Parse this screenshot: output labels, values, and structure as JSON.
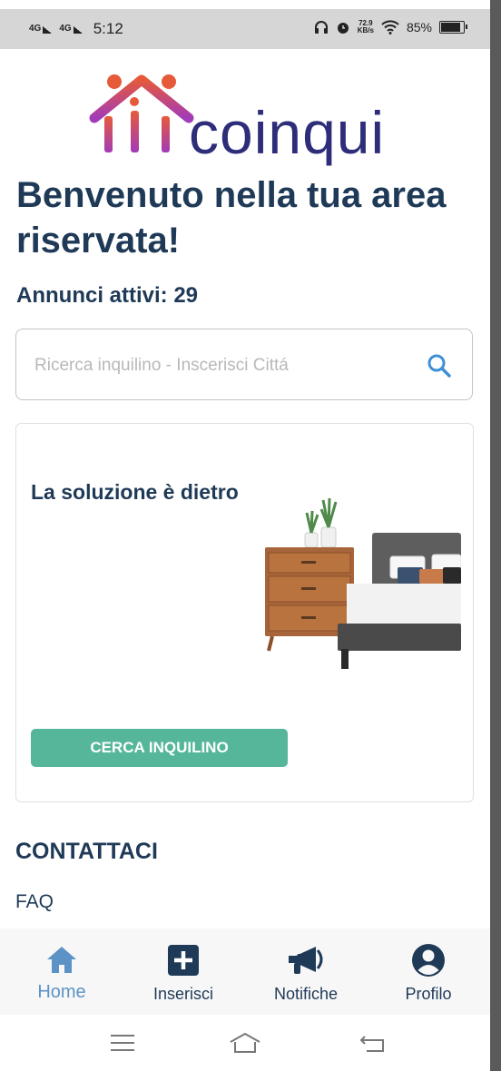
{
  "status_bar": {
    "network_1": "4G",
    "network_2": "4G",
    "time": "5:12",
    "speed_value": "72.9",
    "speed_unit": "KB/s",
    "battery": "85%"
  },
  "logo": {
    "text": "coinqui"
  },
  "header": {
    "title": "Benvenuto nella tua area riservata!",
    "active_ads": "Annunci attivi: 29"
  },
  "search": {
    "placeholder": "Ricerca inquilino - Inscerisci Cittá",
    "value": ""
  },
  "card": {
    "title": "La soluzione è dietro",
    "cta_label": "CERCA INQUILINO"
  },
  "links": {
    "contact": "CONTATTACI",
    "faq": "FAQ"
  },
  "bottom_nav": {
    "items": [
      {
        "label": "Home",
        "icon": "home-icon",
        "active": true
      },
      {
        "label": "Inserisci",
        "icon": "plus-square-icon",
        "active": false
      },
      {
        "label": "Notifiche",
        "icon": "megaphone-icon",
        "active": false
      },
      {
        "label": "Profilo",
        "icon": "user-circle-icon",
        "active": false
      }
    ]
  },
  "colors": {
    "primary_text": "#1f3a57",
    "accent_green": "#56b69a",
    "active_nav": "#5c93c7",
    "logo_text": "#2e2d7a",
    "logo_gradient_top": "#e65a3a",
    "logo_gradient_bottom": "#a23bb8"
  }
}
